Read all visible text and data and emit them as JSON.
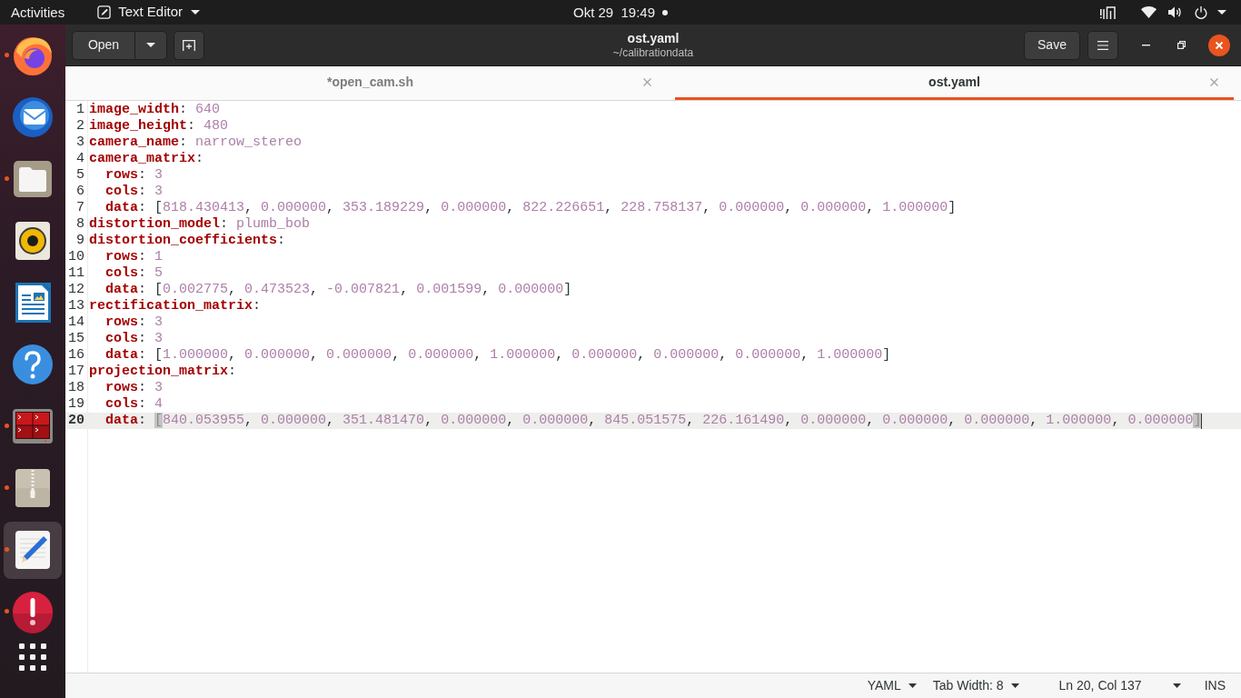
{
  "top_bar": {
    "activities": "Activities",
    "app_menu": "Text Editor",
    "clock": "Okt 29  19:49",
    "notification": true
  },
  "dock": {
    "items": [
      {
        "kind": "browser",
        "running": true,
        "selected": false
      },
      {
        "kind": "mail",
        "running": false,
        "selected": false
      },
      {
        "kind": "files",
        "running": true,
        "selected": false
      },
      {
        "kind": "music",
        "running": false,
        "selected": false
      },
      {
        "kind": "writer",
        "running": false,
        "selected": false
      },
      {
        "kind": "help",
        "running": false,
        "selected": false
      },
      {
        "kind": "terminal",
        "running": true,
        "selected": false
      },
      {
        "kind": "archive",
        "running": true,
        "selected": false
      },
      {
        "kind": "editor",
        "running": true,
        "selected": true
      },
      {
        "kind": "updater",
        "running": true,
        "selected": false
      }
    ]
  },
  "header_bar": {
    "open_button": "Open",
    "title": "ost.yaml",
    "subtitle": "~/calibrationdata",
    "save_button": "Save"
  },
  "tabs": [
    {
      "label": "*open_cam.sh",
      "selected": false
    },
    {
      "label": "ost.yaml",
      "selected": true
    }
  ],
  "editor": {
    "lines": [
      {
        "number": "1",
        "current": false,
        "tokens": [
          {
            "kind": "key",
            "text": "image_width"
          },
          {
            "kind": "punct",
            "text": ": "
          },
          {
            "kind": "scalar",
            "text": "640"
          }
        ]
      },
      {
        "number": "2",
        "current": false,
        "tokens": [
          {
            "kind": "key",
            "text": "image_height"
          },
          {
            "kind": "punct",
            "text": ": "
          },
          {
            "kind": "scalar",
            "text": "480"
          }
        ]
      },
      {
        "number": "3",
        "current": false,
        "tokens": [
          {
            "kind": "key",
            "text": "camera_name"
          },
          {
            "kind": "punct",
            "text": ": "
          },
          {
            "kind": "scalar",
            "text": "narrow_stereo"
          }
        ]
      },
      {
        "number": "4",
        "current": false,
        "tokens": [
          {
            "kind": "key",
            "text": "camera_matrix"
          },
          {
            "kind": "punct",
            "text": ":"
          }
        ],
        "children": [
          {
            "number": "5",
            "current": false,
            "tokens": [
              {
                "kind": "key",
                "text": "rows"
              },
              {
                "kind": "punct",
                "text": ": "
              },
              {
                "kind": "scalar",
                "text": "3"
              }
            ]
          },
          {
            "number": "6",
            "current": false,
            "tokens": [
              {
                "kind": "key",
                "text": "cols"
              },
              {
                "kind": "punct",
                "text": ": "
              },
              {
                "kind": "scalar",
                "text": "3"
              }
            ]
          },
          {
            "number": "7",
            "current": false,
            "tokens": [
              {
                "kind": "key",
                "text": "data"
              },
              {
                "kind": "punct",
                "text": ": "
              },
              {
                "kind": "bracket",
                "text": "[",
                "matched": false
              },
              {
                "kind": "seq",
                "separator": ", ",
                "items": [
                  "818.430413",
                  "0.000000",
                  "353.189229",
                  "0.000000",
                  "822.226651",
                  "228.758137",
                  "0.000000",
                  "0.000000",
                  "1.000000"
                ]
              },
              {
                "kind": "bracket",
                "text": "]",
                "matched": false
              }
            ]
          }
        ]
      },
      {
        "number": "8",
        "current": false,
        "tokens": [
          {
            "kind": "key",
            "text": "distortion_model"
          },
          {
            "kind": "punct",
            "text": ": "
          },
          {
            "kind": "scalar",
            "text": "plumb_bob"
          }
        ]
      },
      {
        "number": "9",
        "current": false,
        "tokens": [
          {
            "kind": "key",
            "text": "distortion_coefficients"
          },
          {
            "kind": "punct",
            "text": ":"
          }
        ],
        "children": [
          {
            "number": "10",
            "current": false,
            "tokens": [
              {
                "kind": "key",
                "text": "rows"
              },
              {
                "kind": "punct",
                "text": ": "
              },
              {
                "kind": "scalar",
                "text": "1"
              }
            ]
          },
          {
            "number": "11",
            "current": false,
            "tokens": [
              {
                "kind": "key",
                "text": "cols"
              },
              {
                "kind": "punct",
                "text": ": "
              },
              {
                "kind": "scalar",
                "text": "5"
              }
            ]
          },
          {
            "number": "12",
            "current": false,
            "tokens": [
              {
                "kind": "key",
                "text": "data"
              },
              {
                "kind": "punct",
                "text": ": "
              },
              {
                "kind": "bracket",
                "text": "[",
                "matched": false
              },
              {
                "kind": "seq",
                "separator": ", ",
                "items": [
                  "0.002775",
                  "0.473523",
                  "-0.007821",
                  "0.001599",
                  "0.000000"
                ]
              },
              {
                "kind": "bracket",
                "text": "]",
                "matched": false
              }
            ]
          }
        ]
      },
      {
        "number": "13",
        "current": false,
        "tokens": [
          {
            "kind": "key",
            "text": "rectification_matrix"
          },
          {
            "kind": "punct",
            "text": ":"
          }
        ],
        "children": [
          {
            "number": "14",
            "current": false,
            "tokens": [
              {
                "kind": "key",
                "text": "rows"
              },
              {
                "kind": "punct",
                "text": ": "
              },
              {
                "kind": "scalar",
                "text": "3"
              }
            ]
          },
          {
            "number": "15",
            "current": false,
            "tokens": [
              {
                "kind": "key",
                "text": "cols"
              },
              {
                "kind": "punct",
                "text": ": "
              },
              {
                "kind": "scalar",
                "text": "3"
              }
            ]
          },
          {
            "number": "16",
            "current": false,
            "tokens": [
              {
                "kind": "key",
                "text": "data"
              },
              {
                "kind": "punct",
                "text": ": "
              },
              {
                "kind": "bracket",
                "text": "[",
                "matched": false
              },
              {
                "kind": "seq",
                "separator": ", ",
                "items": [
                  "1.000000",
                  "0.000000",
                  "0.000000",
                  "0.000000",
                  "1.000000",
                  "0.000000",
                  "0.000000",
                  "0.000000",
                  "1.000000"
                ]
              },
              {
                "kind": "bracket",
                "text": "]",
                "matched": false
              }
            ]
          }
        ]
      },
      {
        "number": "17",
        "current": false,
        "tokens": [
          {
            "kind": "key",
            "text": "projection_matrix"
          },
          {
            "kind": "punct",
            "text": ":"
          }
        ],
        "children": [
          {
            "number": "18",
            "current": false,
            "tokens": [
              {
                "kind": "key",
                "text": "rows"
              },
              {
                "kind": "punct",
                "text": ": "
              },
              {
                "kind": "scalar",
                "text": "3"
              }
            ]
          },
          {
            "number": "19",
            "current": false,
            "tokens": [
              {
                "kind": "key",
                "text": "cols"
              },
              {
                "kind": "punct",
                "text": ": "
              },
              {
                "kind": "scalar",
                "text": "4"
              }
            ]
          },
          {
            "number": "20",
            "current": true,
            "tokens": [
              {
                "kind": "key",
                "text": "data"
              },
              {
                "kind": "punct",
                "text": ": "
              },
              {
                "kind": "bracket",
                "text": "[",
                "matched": true
              },
              {
                "kind": "seq",
                "separator": ", ",
                "items": [
                  "840.053955",
                  "0.000000",
                  "351.481470",
                  "0.000000",
                  "0.000000",
                  "845.051575",
                  "226.161490",
                  "0.000000",
                  "0.000000",
                  "0.000000",
                  "1.000000",
                  "0.000000"
                ]
              },
              {
                "kind": "bracket",
                "text": "]",
                "matched": true
              }
            ]
          }
        ]
      }
    ]
  },
  "status_bar": {
    "language": "YAML",
    "tab_width": "Tab Width: 8",
    "position": "Ln 20, Col 137",
    "mode": "INS"
  }
}
